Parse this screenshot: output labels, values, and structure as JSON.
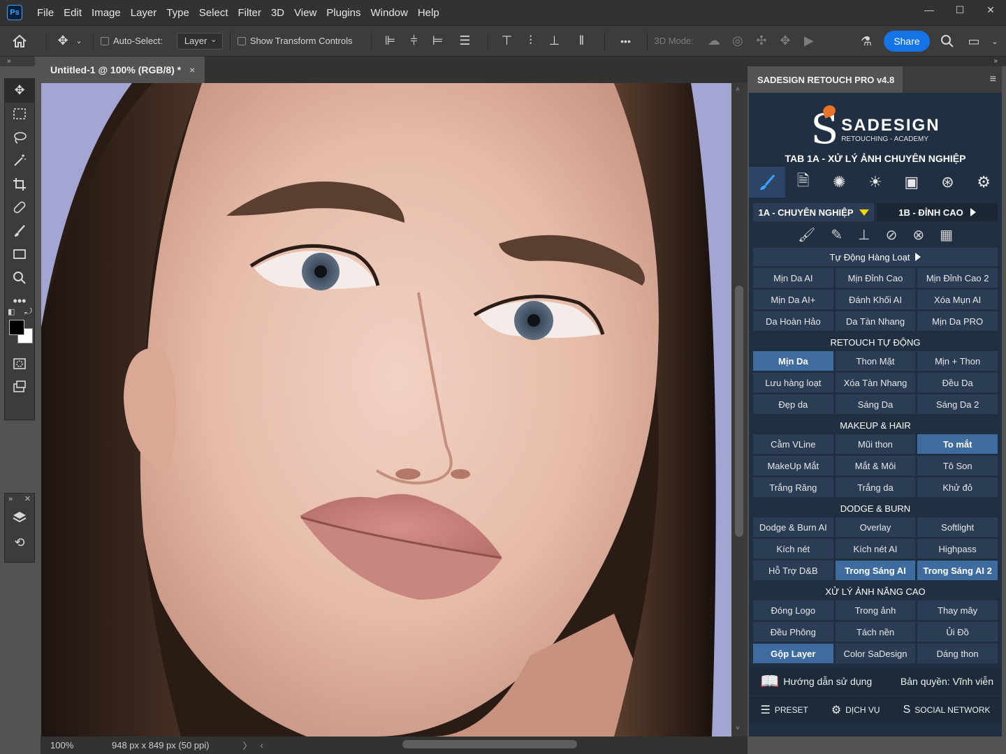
{
  "menubar": {
    "app_icon": "Ps",
    "items": [
      "File",
      "Edit",
      "Image",
      "Layer",
      "Type",
      "Select",
      "Filter",
      "3D",
      "View",
      "Plugins",
      "Window",
      "Help"
    ]
  },
  "options": {
    "auto_select_label": "Auto-Select:",
    "auto_select_value": "Layer",
    "transform_label": "Show Transform Controls",
    "more": "•••",
    "mode_3d_label": "3D Mode:",
    "share_label": "Share"
  },
  "document": {
    "tab_title": "Untitled-1 @ 100% (RGB/8) *",
    "close": "×",
    "zoom": "100%",
    "dimensions": "948 px x 849 px (50 ppi)"
  },
  "panel": {
    "title": "SADESIGN RETOUCH PRO v4.8",
    "logo_name": "SADESIGN",
    "logo_sub": "RETOUCHING - ACADEMY",
    "tab_title": "TAB 1A - XỬ LÝ ẢNH CHUYÊN NGHIỆP",
    "subtab_left": "1A - CHUYÊN NGHIỆP",
    "subtab_right": "1B - ĐỈNH CAO",
    "auto_batch": "Tự Động Hàng Loạt",
    "group1": [
      "Mịn Da AI",
      "Mịn Đỉnh Cao",
      "Mịn Đỉnh Cao 2",
      "Mịn Da AI+",
      "Đánh Khối AI",
      "Xóa Mụn AI",
      "Da Hoàn Hảo",
      "Da Tàn Nhang",
      "Mịn Da PRO"
    ],
    "section_auto": "RETOUCH TỰ ĐỘNG",
    "group2": [
      "Mịn Da",
      "Thon Mặt",
      "Mịn + Thon",
      "Lưu hàng loạt",
      "Xóa Tàn Nhang",
      "Đều Da",
      "Đẹp da",
      "Sáng Da",
      "Sáng Da 2"
    ],
    "section_makeup": "MAKEUP & HAIR",
    "group3": [
      "Cằm VLine",
      "Mũi thon",
      "To mắt",
      "MakeUp Mắt",
      "Mắt & Môi",
      "Tô Son",
      "Trắng Răng",
      "Trắng da",
      "Khử đỏ"
    ],
    "section_dodge": "DODGE & BURN",
    "group4": [
      "Dodge & Burn AI",
      "Overlay",
      "Softlight",
      "Kích nét",
      "Kích nét AI",
      "Highpass",
      "Hỗ Trợ D&B",
      "Trong Sáng AI",
      "Trong Sáng AI 2"
    ],
    "section_advanced": "XỬ LÝ ẢNH NÂNG CAO",
    "group5": [
      "Đóng Logo",
      "Trong ảnh",
      "Thay mây",
      "Đều Phông",
      "Tách nền",
      "Ủi Đồ",
      "Gộp Layer",
      "Color SaDesign",
      "Dáng thon"
    ],
    "guide": "Hướng dẫn sử dụng",
    "license": "Bản quyền: Vĩnh viễn",
    "footer_preset": "PRESET",
    "footer_service": "DỊCH VỤ",
    "footer_social": "SOCIAL NETWORK"
  },
  "colors": {
    "accent": "#1473e6",
    "panel_bg": "#202f41",
    "button_bg": "#2b3d55",
    "highlight": "#3f6c9e",
    "canvas_bg": "#9fa3cf"
  }
}
